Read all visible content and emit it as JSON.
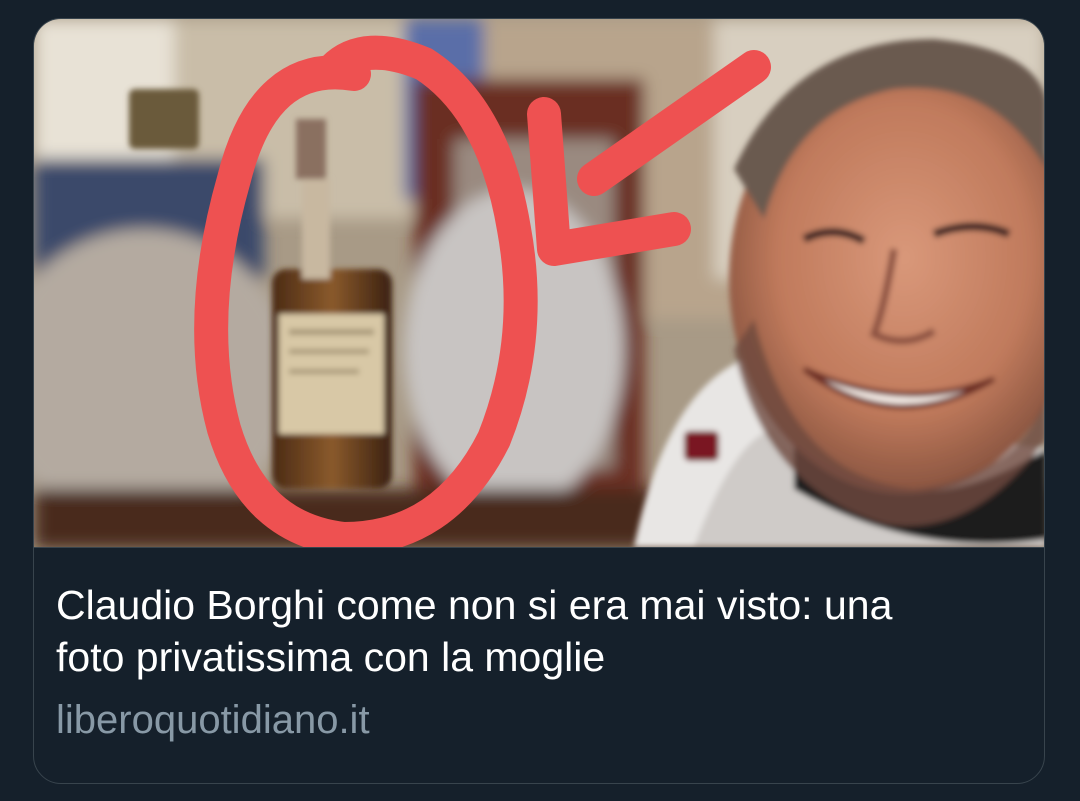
{
  "link_card": {
    "title": "Claudio Borghi come non si era mai visto: una foto privatissima con la moglie",
    "domain": "liberoquotidiano.it",
    "image": {
      "subject": "photo-man-smiling-with-bottle",
      "annotation_color": "#ee5151"
    }
  },
  "colors": {
    "background": "#15202b",
    "card_border": "#38444d",
    "title_text": "#ffffff",
    "domain_text": "#8899a6"
  }
}
